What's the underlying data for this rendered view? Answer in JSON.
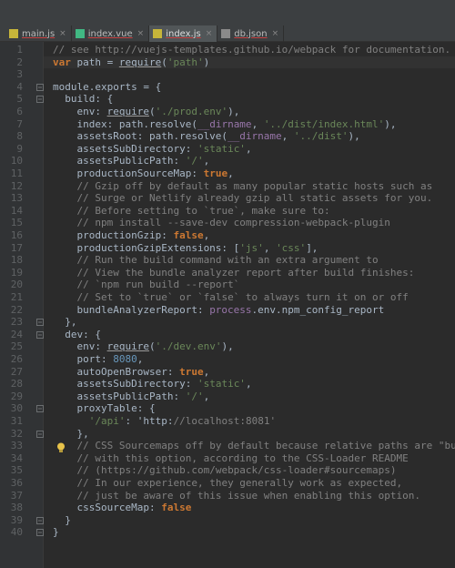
{
  "tabs": [
    {
      "label": "main.js",
      "type": "js",
      "active": false
    },
    {
      "label": "index.vue",
      "type": "vue",
      "active": false
    },
    {
      "label": "index.js",
      "type": "js",
      "active": true
    },
    {
      "label": "db.json",
      "type": "json",
      "active": false
    }
  ],
  "close_glyph": "×",
  "lines": [
    "// see http://vuejs-templates.github.io/webpack for documentation.",
    "var path = require('path')",
    "",
    "module.exports = {",
    "  build: {",
    "    env: require('./prod.env'),",
    "    index: path.resolve(__dirname, '../dist/index.html'),",
    "    assetsRoot: path.resolve(__dirname, '../dist'),",
    "    assetsSubDirectory: 'static',",
    "    assetsPublicPath: '/',",
    "    productionSourceMap: true,",
    "    // Gzip off by default as many popular static hosts such as",
    "    // Surge or Netlify already gzip all static assets for you.",
    "    // Before setting to `true`, make sure to:",
    "    // npm install --save-dev compression-webpack-plugin",
    "    productionGzip: false,",
    "    productionGzipExtensions: ['js', 'css'],",
    "    // Run the build command with an extra argument to",
    "    // View the bundle analyzer report after build finishes:",
    "    // `npm run build --report`",
    "    // Set to `true` or `false` to always turn it on or off",
    "    bundleAnalyzerReport: process.env.npm_config_report",
    "  },",
    "  dev: {",
    "    env: require('./dev.env'),",
    "    port: 8080,",
    "    autoOpenBrowser: true,",
    "    assetsSubDirectory: 'static',",
    "    assetsPublicPath: '/',",
    "    proxyTable: {",
    "      '/api': 'http://localhost:8081'",
    "    },",
    "    // CSS Sourcemaps off by default because relative paths are \"buggy\"",
    "    // with this option, according to the CSS-Loader README",
    "    // (https://github.com/webpack/css-loader#sourcemaps)",
    "    // In our experience, they generally work as expected,",
    "    // just be aware of this issue when enabling this option.",
    "    cssSourceMap: false",
    "  }",
    "}"
  ],
  "colors": {
    "keyword": "#cc7832",
    "string": "#6a8759",
    "comment": "#808080",
    "number": "#6897bb",
    "global": "#9876aa",
    "text": "#a9b7c6",
    "background": "#2b2b2b"
  },
  "icons": {
    "intention": "lightbulb-icon",
    "fold": "fold-marker-icon"
  }
}
